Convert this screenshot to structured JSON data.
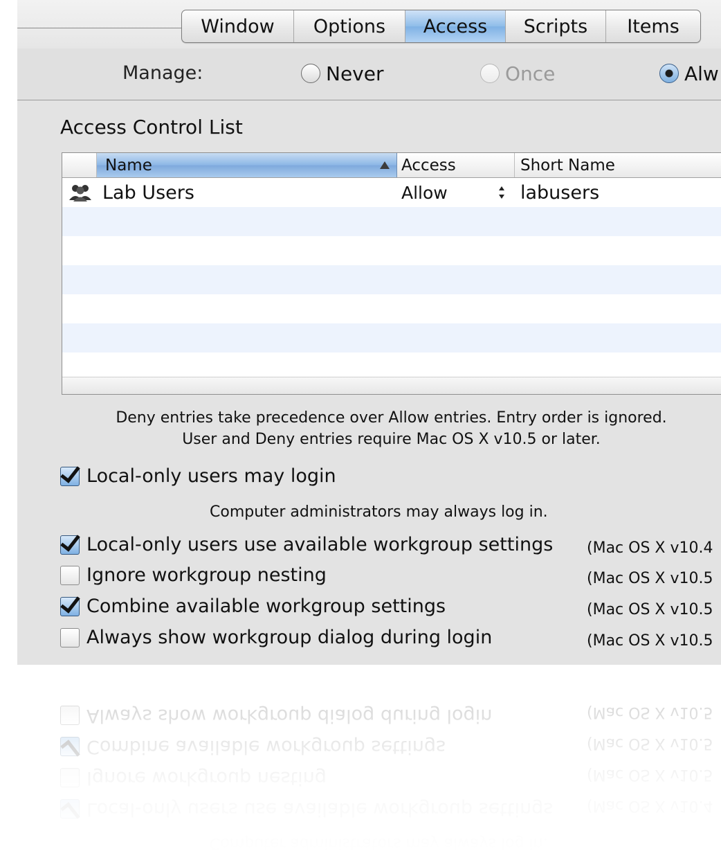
{
  "tabs": [
    {
      "label": "Window",
      "active": false
    },
    {
      "label": "Options",
      "active": false
    },
    {
      "label": "Access",
      "active": true
    },
    {
      "label": "Scripts",
      "active": false
    },
    {
      "label": "Items",
      "active": false
    }
  ],
  "manage": {
    "label": "Manage:",
    "options": [
      {
        "label": "Never",
        "state": "unselected"
      },
      {
        "label": "Once",
        "state": "disabled"
      },
      {
        "label": "Alw",
        "state": "selected"
      }
    ]
  },
  "acl": {
    "title": "Access Control List",
    "columns": {
      "name": "Name",
      "access": "Access",
      "short_name": "Short Name"
    },
    "sort": {
      "column": "Name",
      "direction": "ascending"
    },
    "rows": [
      {
        "icon": "group-icon",
        "name": "Lab Users",
        "access": "Allow",
        "short_name": "labusers"
      }
    ]
  },
  "notes": {
    "line1": "Deny entries take precedence over Allow entries. Entry order is ignored.",
    "line2": "User and Deny entries require Mac OS X v10.5 or later."
  },
  "options": {
    "local_login": {
      "label": "Local-only users may login",
      "checked": true
    },
    "admin_note": "Computer administrators may always log in.",
    "workgroup_settings": {
      "label": "Local-only users use available workgroup settings",
      "checked": true,
      "version": "(Mac OS X v10.4"
    },
    "ignore_nesting": {
      "label": "Ignore workgroup nesting",
      "checked": false,
      "version": "(Mac OS X v10.5"
    },
    "combine_settings": {
      "label": "Combine available workgroup settings",
      "checked": true,
      "version": "(Mac OS X v10.5"
    },
    "always_show_dialog": {
      "label": "Always show workgroup dialog during login",
      "checked": false,
      "version": "(Mac OS X v10.5"
    }
  },
  "colors": {
    "panel": "#e3e3e3",
    "accent": "#7fb1e4",
    "row_alt": "#edf3fd"
  }
}
